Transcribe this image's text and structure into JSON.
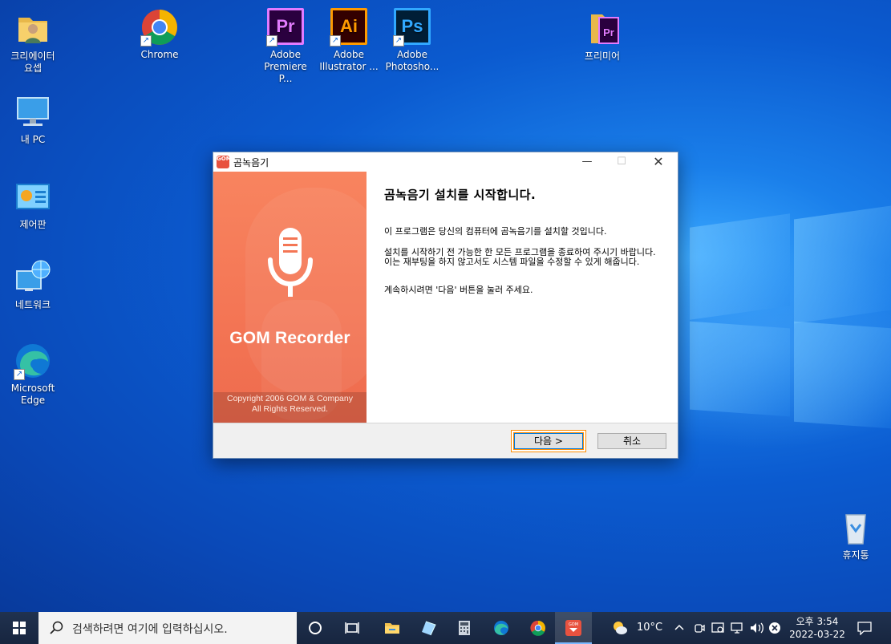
{
  "desktop": {
    "icons": [
      {
        "label": "크리에이터\n요셉"
      },
      {
        "label": "Chrome"
      },
      {
        "label": "Adobe\nPremiere P..."
      },
      {
        "label": "Adobe\nIllustrator ..."
      },
      {
        "label": "Adobe\nPhotosho..."
      },
      {
        "label": "프리미어"
      },
      {
        "label": "내 PC"
      },
      {
        "label": "제어판"
      },
      {
        "label": "네트워크"
      },
      {
        "label": "Microsoft\nEdge"
      },
      {
        "label": "휴지통"
      }
    ],
    "adobe_glyphs": {
      "pr": "Pr",
      "ai": "Ai",
      "ps": "Ps",
      "pr_small": "Pr"
    }
  },
  "installer": {
    "window_title": "곰녹음기",
    "app_icon_text": "GOM",
    "controls": {
      "minimize": "—",
      "maximize": "☐",
      "close": "✕"
    },
    "brand": "GOM Recorder",
    "copyright_line1": "Copyright 2006 GOM & Company",
    "copyright_line2": "All Rights Reserved.",
    "heading": "곰녹음기 설치를 시작합니다.",
    "paragraph1": "이 프로그램은 당신의 컴퓨터에 곰녹음기를 설치할 것입니다.",
    "paragraph2": "설치를 시작하기 전 가능한 한 모든 프로그램을 종료하여 주시기 바랍니다. 이는 재부팅을 하지 않고서도 시스템 파일을 수정할 수 있게 해줍니다.",
    "paragraph3": "계속하시려면 '다음' 버튼을 눌러 주세요.",
    "next_label": "다음 >",
    "cancel_label": "취소"
  },
  "taskbar": {
    "search_placeholder": "검색하려면 여기에 입력하십시오.",
    "weather": "10°C",
    "time": "오후 3:54",
    "date": "2022-03-22",
    "gom_icon_text": "GOM"
  },
  "colors": {
    "banner": "#f47655",
    "accent_focus": "#ff8c00",
    "taskbar": "#1b2a46"
  }
}
